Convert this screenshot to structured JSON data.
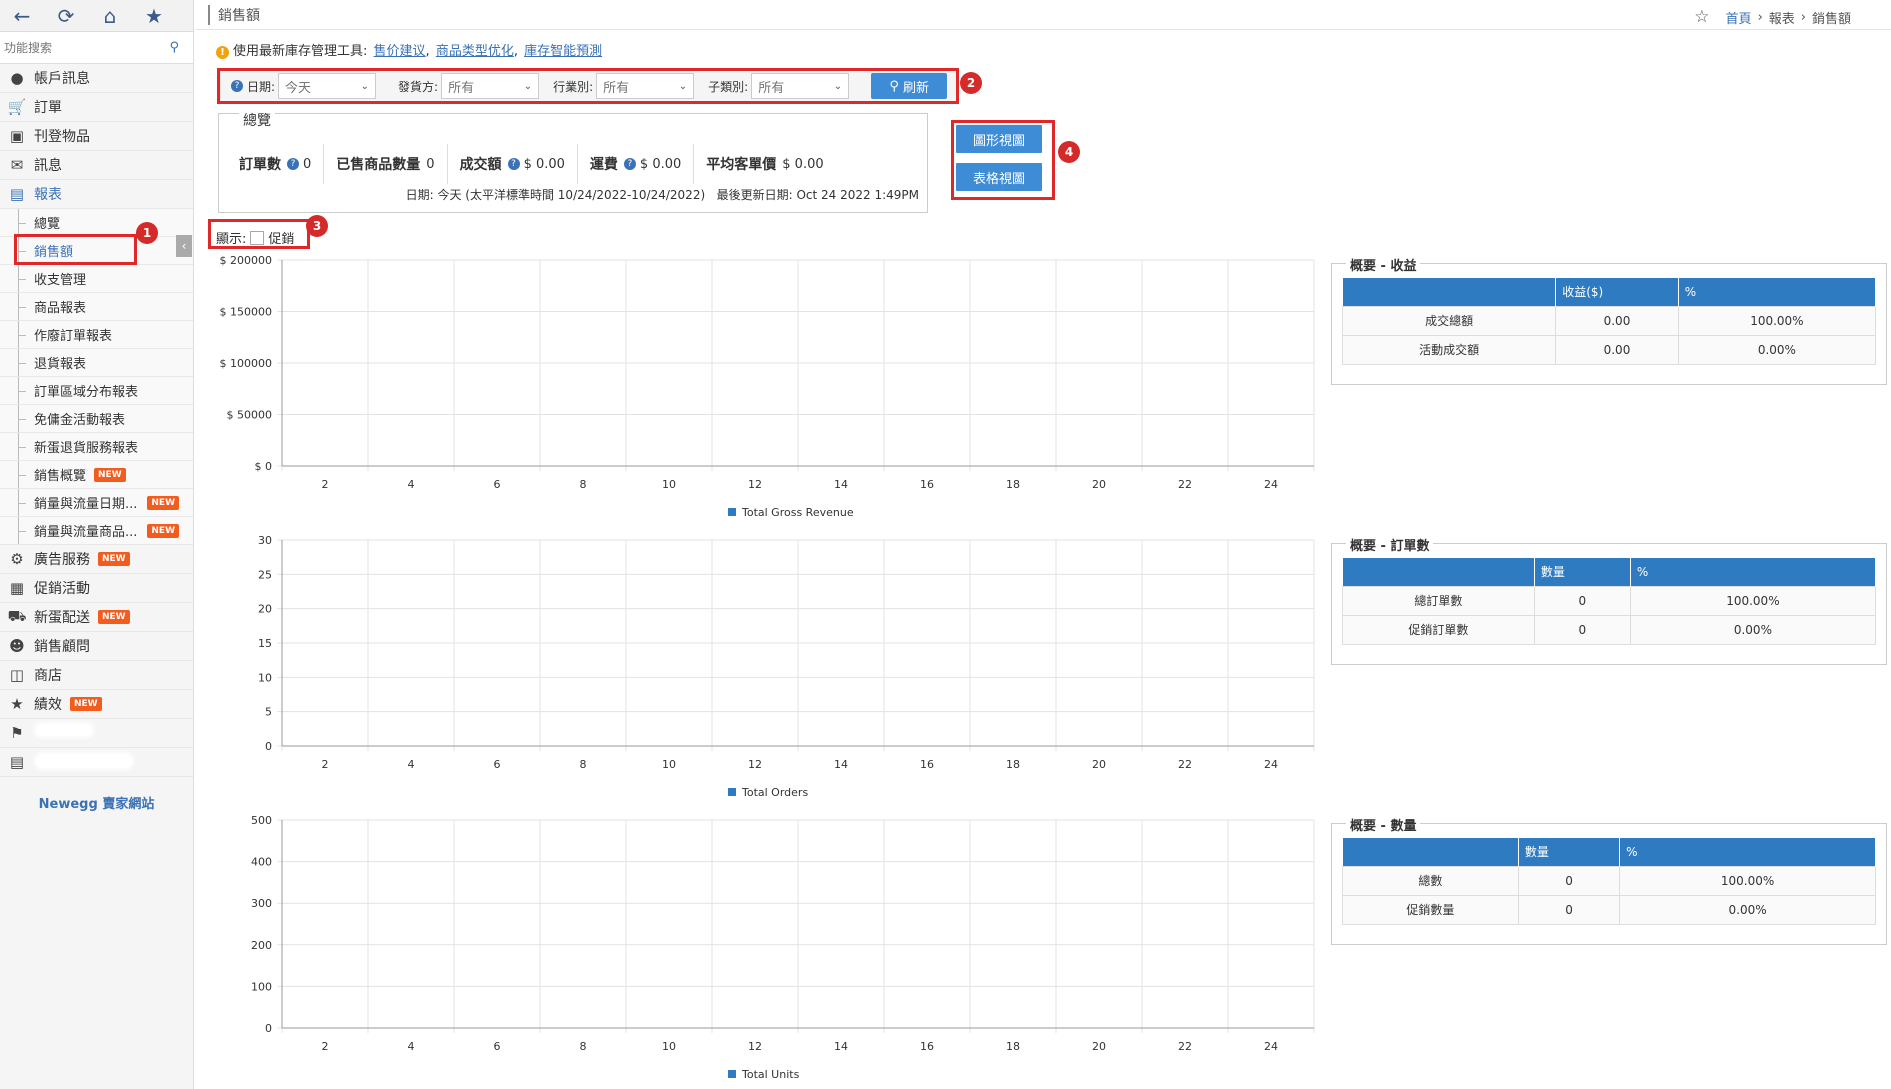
{
  "sidebar": {
    "search_placeholder": "功能搜索",
    "menu": [
      {
        "label": "帳戶訊息",
        "icon": "user-icon"
      },
      {
        "label": "訂單",
        "icon": "cart-icon"
      },
      {
        "label": "刊登物品",
        "icon": "box-icon"
      },
      {
        "label": "訊息",
        "icon": "mail-icon"
      },
      {
        "label": "報表",
        "icon": "bar-chart-icon"
      }
    ],
    "report_items": [
      {
        "label": "總覽"
      },
      {
        "label": "銷售額"
      },
      {
        "label": "收支管理"
      },
      {
        "label": "商品報表"
      },
      {
        "label": "作廢訂單報表"
      },
      {
        "label": "退貨報表"
      },
      {
        "label": "訂單區域分布報表"
      },
      {
        "label": "免傭金活動報表"
      },
      {
        "label": "新蛋退貨服務報表"
      },
      {
        "label": "銷售概覽",
        "badge": "NEW"
      },
      {
        "label": "銷量與流量日期...",
        "badge": "NEW"
      },
      {
        "label": "銷量與流量商品...",
        "badge": "NEW"
      }
    ],
    "menu2": [
      {
        "label": "廣告服務",
        "icon": "gears-icon",
        "badge": "NEW"
      },
      {
        "label": "促銷活動",
        "icon": "gift-icon"
      },
      {
        "label": "新蛋配送",
        "icon": "truck-icon",
        "badge": "NEW"
      },
      {
        "label": "銷售顧問",
        "icon": "advisor-icon"
      },
      {
        "label": "商店",
        "icon": "store-icon"
      },
      {
        "label": "績效",
        "icon": "star-icon",
        "badge": "NEW"
      }
    ],
    "footer_link": "Newegg 賣家網站"
  },
  "header": {
    "title": "銷售額",
    "breadcrumb": [
      "首頁",
      "報表",
      "銷售額"
    ]
  },
  "tip": {
    "text": "使用最新庫存管理工具:",
    "links": [
      "售价建议",
      "商品类型优化",
      "庫存智能預測"
    ]
  },
  "filters": {
    "date_label": "日期:",
    "date_value": "今天",
    "shipper_label": "發貨方:",
    "shipper_value": "所有",
    "industry_label": "行業別:",
    "industry_value": "所有",
    "subcat_label": "子類別:",
    "subcat_value": "所有",
    "refresh_label": "刷新"
  },
  "summary": {
    "legend": "總覽",
    "orders_label": "訂單數",
    "orders_value": "0",
    "items_label": "已售商品數量",
    "items_value": "0",
    "gmv_label": "成交額",
    "gmv_value": "$ 0.00",
    "shipping_label": "運費",
    "shipping_value": "$ 0.00",
    "avg_label": "平均客單價",
    "avg_value": "$ 0.00",
    "date_text": "日期: 今天 (太平洋標準時間 10/24/2022-10/24/2022)",
    "updated_text": "最後更新日期: Oct 24 2022 1:49PM"
  },
  "view_buttons": {
    "chart": "圖形視圖",
    "table": "表格視圖"
  },
  "display": {
    "label": "顯示:",
    "option": "促銷"
  },
  "annotations": [
    "1",
    "2",
    "3",
    "4"
  ],
  "colors": {
    "accent": "#3e8bd6",
    "header_blue": "#2f7bc2",
    "annotation_red": "#e0282b",
    "series": "#2f7bc2"
  },
  "chart_data": [
    {
      "type": "line",
      "x": [
        2,
        4,
        6,
        8,
        10,
        12,
        14,
        16,
        18,
        20,
        22,
        24
      ],
      "y_ticks": [
        "$ 0",
        "$ 50000",
        "$ 100000",
        "$ 150000",
        "$ 200000"
      ],
      "ylim": [
        0,
        200000
      ],
      "series": [
        {
          "name": "Total Gross Revenue",
          "values": []
        }
      ],
      "grid": true,
      "legend": "bottom"
    },
    {
      "type": "line",
      "x": [
        2,
        4,
        6,
        8,
        10,
        12,
        14,
        16,
        18,
        20,
        22,
        24
      ],
      "y_ticks": [
        "0",
        "5",
        "10",
        "15",
        "20",
        "25",
        "30"
      ],
      "ylim": [
        0,
        30
      ],
      "series": [
        {
          "name": "Total Orders",
          "values": []
        }
      ],
      "grid": true,
      "legend": "bottom"
    },
    {
      "type": "line",
      "x": [
        2,
        4,
        6,
        8,
        10,
        12,
        14,
        16,
        18,
        20,
        22,
        24
      ],
      "y_ticks": [
        "0",
        "100",
        "200",
        "300",
        "400",
        "500"
      ],
      "ylim": [
        0,
        500
      ],
      "series": [
        {
          "name": "Total Units",
          "values": []
        }
      ],
      "grid": true,
      "legend": "bottom"
    }
  ],
  "side_tables": [
    {
      "legend": "概要 - 收益",
      "headers": [
        "",
        "收益($)",
        "%"
      ],
      "rows": [
        [
          "成交總額",
          "0.00",
          "100.00%"
        ],
        [
          "活動成交額",
          "0.00",
          "0.00%"
        ]
      ]
    },
    {
      "legend": "概要 - 訂單數",
      "headers": [
        "",
        "數量",
        "%"
      ],
      "rows": [
        [
          "總訂單數",
          "0",
          "100.00%"
        ],
        [
          "促銷訂單數",
          "0",
          "0.00%"
        ]
      ]
    },
    {
      "legend": "概要 - 數量",
      "headers": [
        "",
        "數量",
        "%"
      ],
      "rows": [
        [
          "總數",
          "0",
          "100.00%"
        ],
        [
          "促銷數量",
          "0",
          "0.00%"
        ]
      ]
    }
  ]
}
